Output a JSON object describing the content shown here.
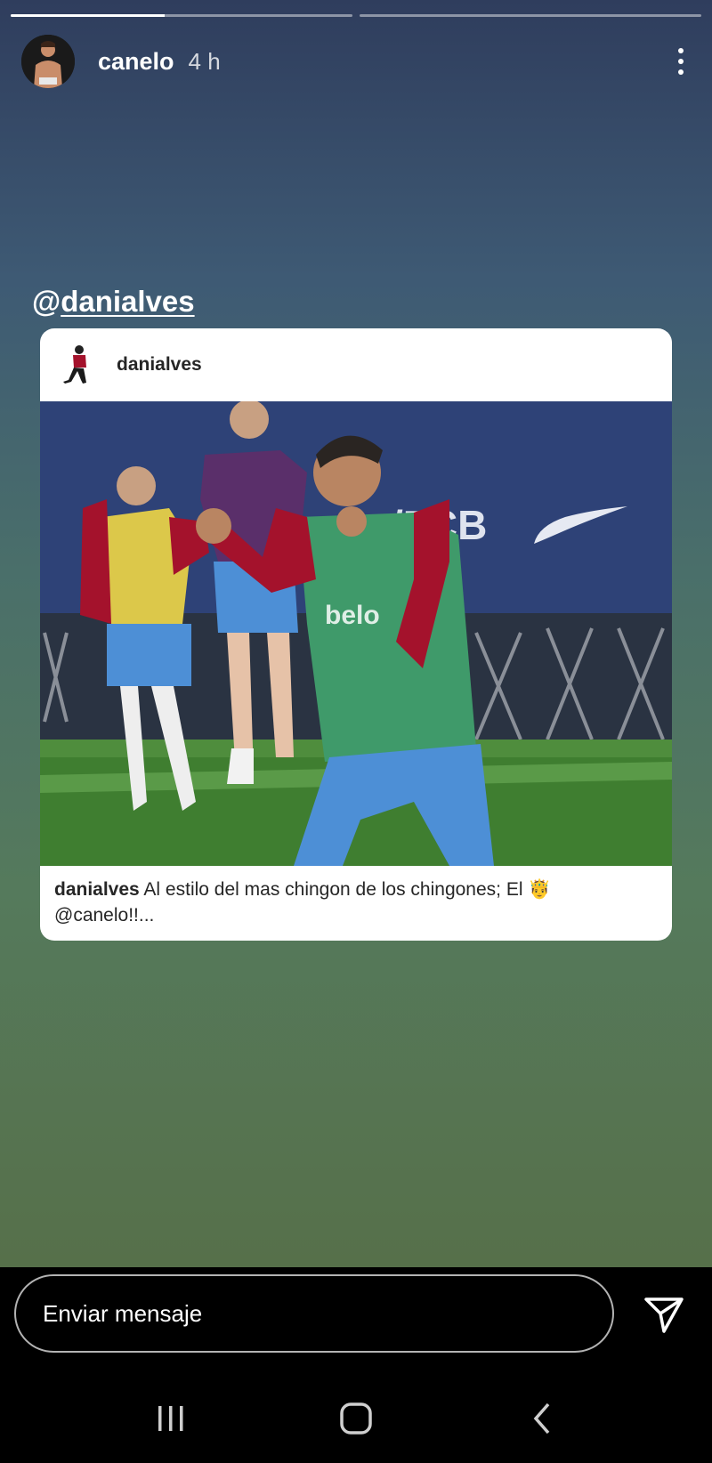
{
  "story": {
    "progress_segments": [
      0.45,
      0.0
    ],
    "user": "canelo",
    "time": "4 h",
    "mention_at": "@",
    "mention_name": "danialves"
  },
  "card": {
    "username": "danialves",
    "caption_user": "danialves",
    "caption_text": "Al estilo del mas chingon de los chingones; El 🤴",
    "caption_more": "@canelo!!...",
    "photo_text": {
      "fcb": "/FCB",
      "sponsor": "belo"
    }
  },
  "reply": {
    "placeholder": "Enviar mensaje"
  },
  "colors": {
    "story_top": "#2f3d5d",
    "story_bottom": "#56704a",
    "bib_green": "#3f9a6a",
    "bib_yellow": "#dcc84a",
    "kit_red": "#a4122c",
    "shorts_blue": "#4d8fd6"
  },
  "icons": [
    "more-vertical-icon",
    "send-icon",
    "recents-nav-icon",
    "home-nav-icon",
    "back-nav-icon"
  ]
}
